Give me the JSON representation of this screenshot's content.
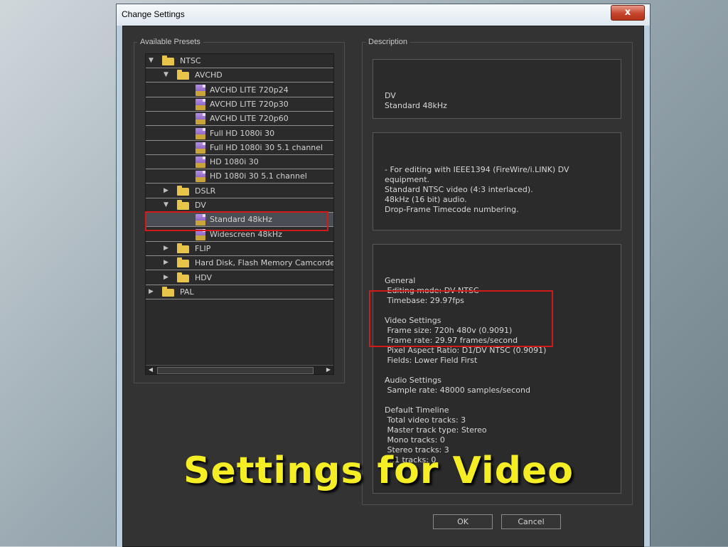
{
  "window": {
    "title": "Change Settings",
    "close_label": "x"
  },
  "presets": {
    "legend": "Available Presets",
    "items": [
      {
        "label": "NTSC",
        "depth": 0,
        "kind": "folder",
        "expanded": true
      },
      {
        "label": "AVCHD",
        "depth": 1,
        "kind": "folder",
        "expanded": true
      },
      {
        "label": "AVCHD LITE 720p24",
        "depth": 2,
        "kind": "preset"
      },
      {
        "label": "AVCHD LITE 720p30",
        "depth": 2,
        "kind": "preset"
      },
      {
        "label": "AVCHD LITE 720p60",
        "depth": 2,
        "kind": "preset"
      },
      {
        "label": "Full HD 1080i 30",
        "depth": 2,
        "kind": "preset"
      },
      {
        "label": "Full HD 1080i 30 5.1 channel",
        "depth": 2,
        "kind": "preset"
      },
      {
        "label": "HD 1080i 30",
        "depth": 2,
        "kind": "preset"
      },
      {
        "label": "HD 1080i 30 5.1 channel",
        "depth": 2,
        "kind": "preset"
      },
      {
        "label": "DSLR",
        "depth": 1,
        "kind": "folder",
        "expanded": false
      },
      {
        "label": "DV",
        "depth": 1,
        "kind": "folder",
        "expanded": true
      },
      {
        "label": "Standard 48kHz",
        "depth": 2,
        "kind": "preset",
        "selected": true
      },
      {
        "label": "Widescreen 48kHz",
        "depth": 2,
        "kind": "preset"
      },
      {
        "label": "FLIP",
        "depth": 1,
        "kind": "folder",
        "expanded": false
      },
      {
        "label": "Hard Disk, Flash Memory Camcorders",
        "depth": 1,
        "kind": "folder",
        "expanded": false
      },
      {
        "label": "HDV",
        "depth": 1,
        "kind": "folder",
        "expanded": false
      },
      {
        "label": "PAL",
        "depth": 0,
        "kind": "folder",
        "expanded": false
      }
    ]
  },
  "description": {
    "legend": "Description",
    "name_lines": [
      "DV",
      "Standard 48kHz"
    ],
    "detail_lines": [
      "- For editing with IEEE1394 (FireWire/i.LINK) DV",
      "equipment.",
      "Standard NTSC video (4:3 interlaced).",
      "48kHz (16 bit) audio.",
      "Drop-Frame Timecode numbering."
    ],
    "summary_lines": [
      "General",
      " Editing mode: DV NTSC",
      " Timebase: 29.97fps",
      "",
      "Video Settings",
      " Frame size: 720h 480v (0.9091)",
      " Frame rate: 29.97 frames/second",
      " Pixel Aspect Ratio: D1/DV NTSC (0.9091)",
      " Fields: Lower Field First",
      "",
      "Audio Settings",
      " Sample rate: 48000 samples/second",
      "",
      "Default Timeline",
      " Total video tracks: 3",
      " Master track type: Stereo",
      " Mono tracks: 0",
      " Stereo tracks: 3",
      " 5.1 tracks: 0"
    ]
  },
  "buttons": {
    "ok": "OK",
    "cancel": "Cancel"
  },
  "overlay": {
    "caption": "Settings for Video"
  },
  "colors": {
    "highlight": "#d11a1a",
    "caption": "#f5ee24"
  }
}
